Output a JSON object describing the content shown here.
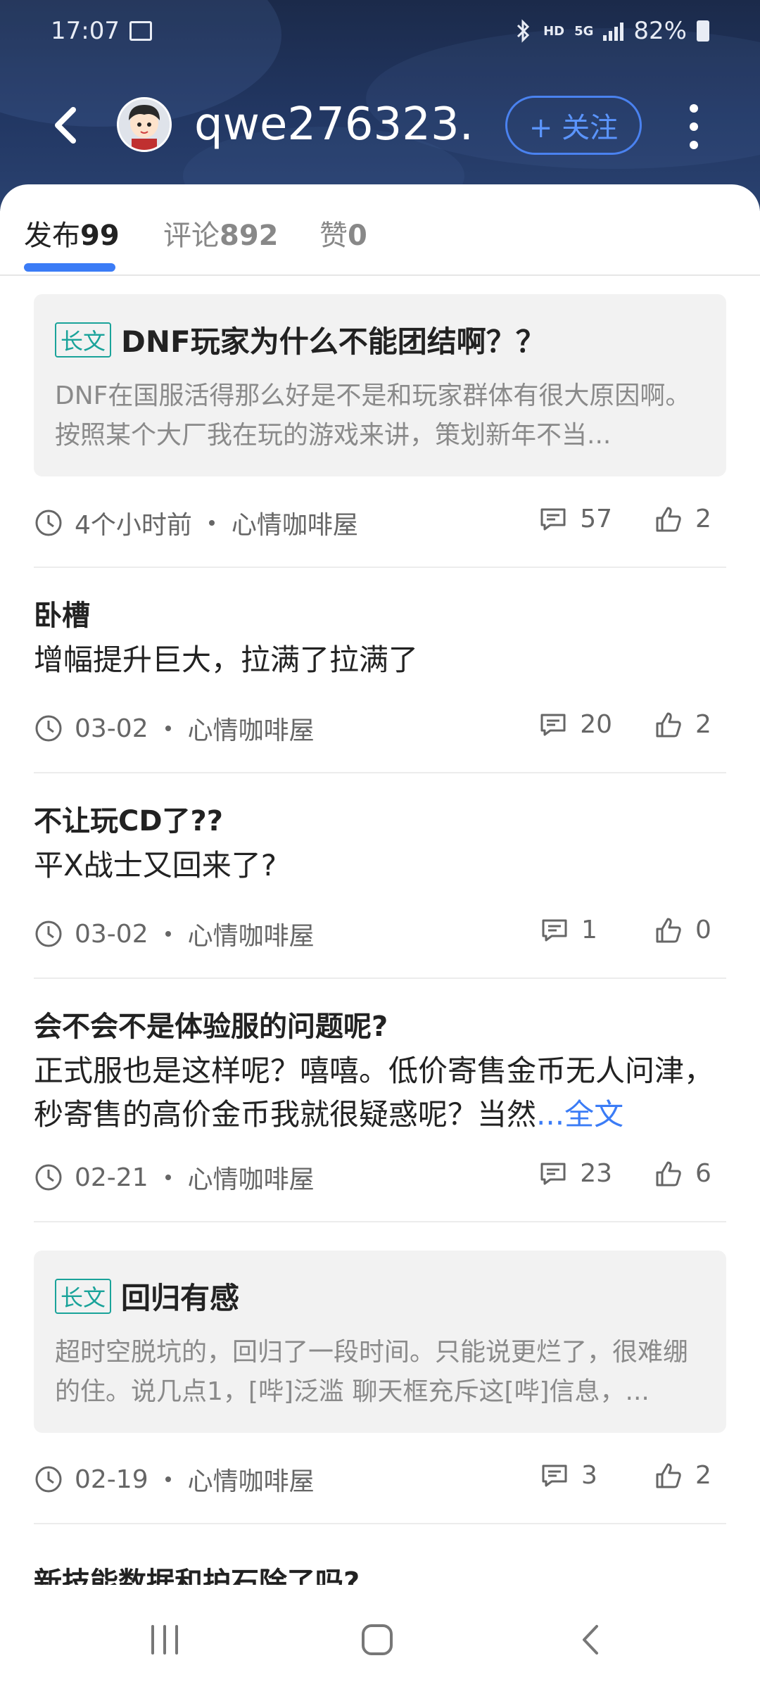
{
  "status_bar": {
    "time": "17:07",
    "network": "HD",
    "network2": "5G",
    "battery": "82%"
  },
  "header": {
    "username": "qwe276323...",
    "follow_label": "+ 关注"
  },
  "tabs": [
    {
      "label": "发布",
      "count": "99"
    },
    {
      "label": "评论",
      "count": "892"
    },
    {
      "label": "赞",
      "count": "0"
    }
  ],
  "posts": [
    {
      "tag": "长文",
      "title": "DNF玩家为什么不能团结啊？？",
      "body": "DNF在国服活得那么好是不是和玩家群体有很大原因啊。按照某个大厂我在玩的游戏来讲，策划新年不当...",
      "time": "4个小时前",
      "source": "心情咖啡屋",
      "comments": "57",
      "likes": "2"
    },
    {
      "title": "卧槽",
      "body": "增幅提升巨大，拉满了拉满了",
      "time": "03-02",
      "source": "心情咖啡屋",
      "comments": "20",
      "likes": "2"
    },
    {
      "title": "不让玩CD了??",
      "body": "平X战士又回来了?",
      "time": "03-02",
      "source": "心情咖啡屋",
      "comments": "1",
      "likes": "0"
    },
    {
      "title": "会不会不是体验服的问题呢?",
      "body": "正式服也是这样呢？嘻嘻。低价寄售金币无人问津，秒寄售的高价金币我就很疑惑呢？当然",
      "full_link": "...全文",
      "time": "02-21",
      "source": "心情咖啡屋",
      "comments": "23",
      "likes": "6"
    },
    {
      "tag": "长文",
      "title": "回归有感",
      "body": "超时空脱坑的，回归了一段时间。只能说更烂了，很难绷的住。说几点1，[哔]泛滥 聊天框充斥这[哔]信息，...",
      "time": "02-19",
      "source": "心情咖啡屋",
      "comments": "3",
      "likes": "2"
    }
  ],
  "cut_post_title": "新技能数据和护石除了吗?",
  "colors": {
    "accent": "#3b7cf6",
    "tag": "#1aa39a",
    "header": "#223763"
  }
}
